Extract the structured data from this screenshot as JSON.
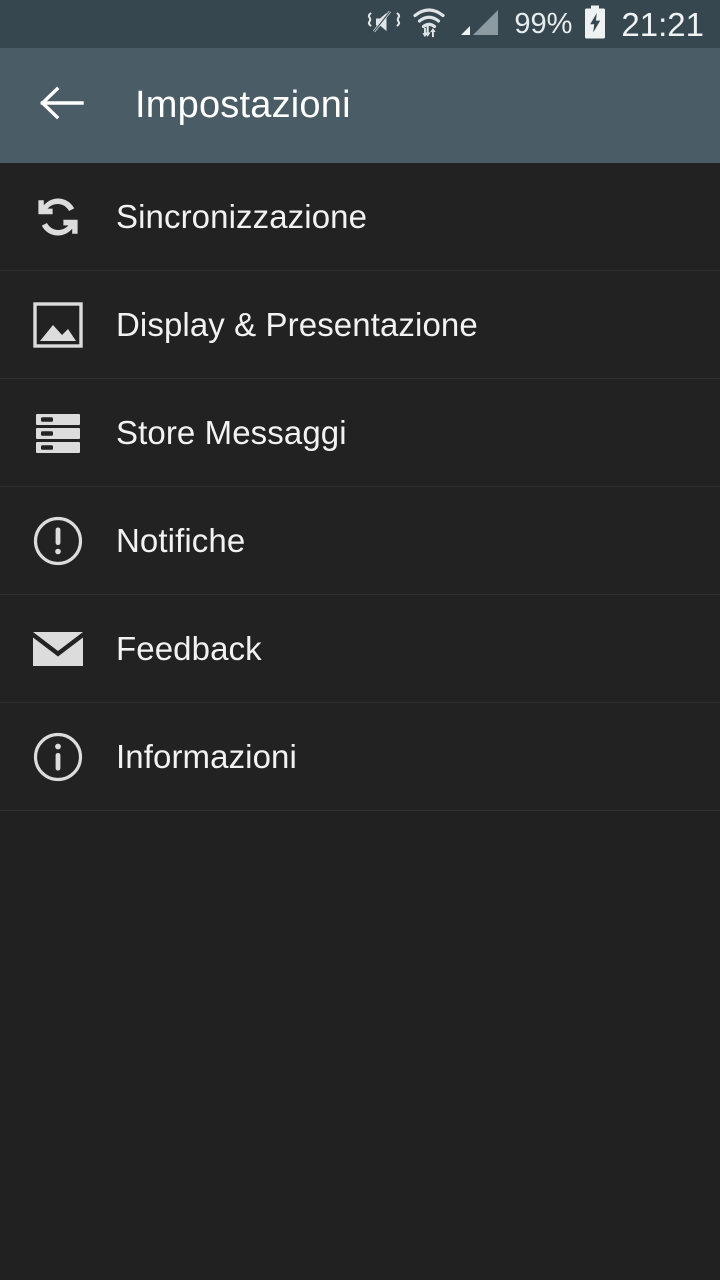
{
  "status_bar": {
    "icons": [
      {
        "name": "vibrate-mute-icon",
        "label": "Silenzioso / vibrazione"
      },
      {
        "name": "wifi-icon",
        "label": "Wi-Fi connesso"
      },
      {
        "name": "signal-icon",
        "label": "Segnale rete"
      }
    ],
    "battery_percent": "99%",
    "battery_icon": "battery-charging-icon",
    "clock": "21:21",
    "background_color": "#37474f",
    "text_color": "#e8eced"
  },
  "app_bar": {
    "back_icon": "arrow-back-icon",
    "title": "Impostazioni",
    "background_color": "#4a5c66",
    "title_color": "#ffffff"
  },
  "settings": {
    "background_color": "#222222",
    "divider_color": "#303030",
    "label_color": "#f2f2f2",
    "items": [
      {
        "label": "Sincronizzazione",
        "icon": "sync-icon"
      },
      {
        "label": "Display & Presentazione",
        "icon": "image-icon"
      },
      {
        "label": "Store Messaggi",
        "icon": "storage-icon"
      },
      {
        "label": "Notifiche",
        "icon": "alert-circle-icon"
      },
      {
        "label": "Feedback",
        "icon": "envelope-icon"
      },
      {
        "label": "Informazioni",
        "icon": "info-circle-icon"
      }
    ]
  },
  "empty_area": {
    "background_color": "#212121"
  }
}
